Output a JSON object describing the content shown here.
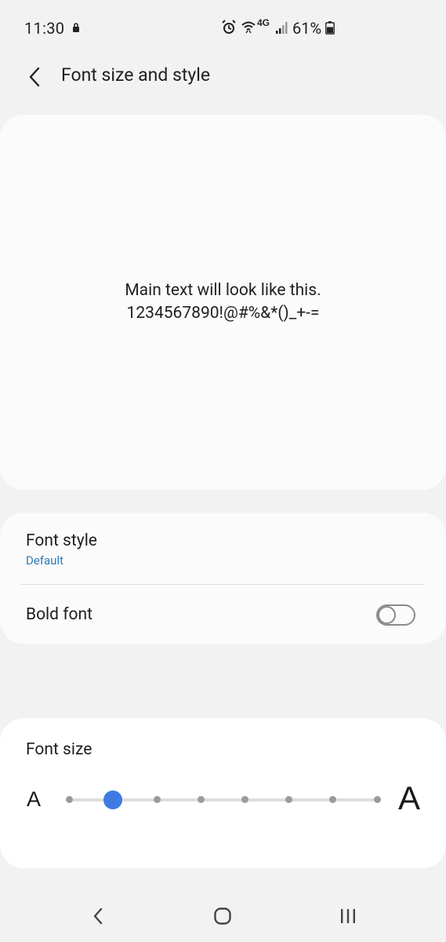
{
  "status_bar": {
    "time": "11:30",
    "battery_text": "61%",
    "network_label": "4G",
    "icons": [
      "lock-icon",
      "alarm-icon",
      "wifi-icon",
      "4g-icon",
      "signal-icon",
      "battery-icon"
    ]
  },
  "header": {
    "title": "Font size and style",
    "back_icon": "chevron-left-icon"
  },
  "preview": {
    "line1": "Main text will look like this.",
    "line2": "1234567890!@#%&*()_+-="
  },
  "settings": {
    "font_style": {
      "title": "Font style",
      "value": "Default"
    },
    "bold_font": {
      "label": "Bold font",
      "enabled": false
    }
  },
  "font_size": {
    "title": "Font size",
    "small_label": "A",
    "large_label": "A",
    "steps": 8,
    "selected_index": 1
  },
  "colors": {
    "accent": "#3d7be3",
    "link": "#2e7bb4",
    "background": "#f2f2f2",
    "card": "#fbfbfb"
  },
  "nav_bar": {
    "back": "back-icon",
    "home": "home-icon",
    "recents": "recents-icon"
  }
}
